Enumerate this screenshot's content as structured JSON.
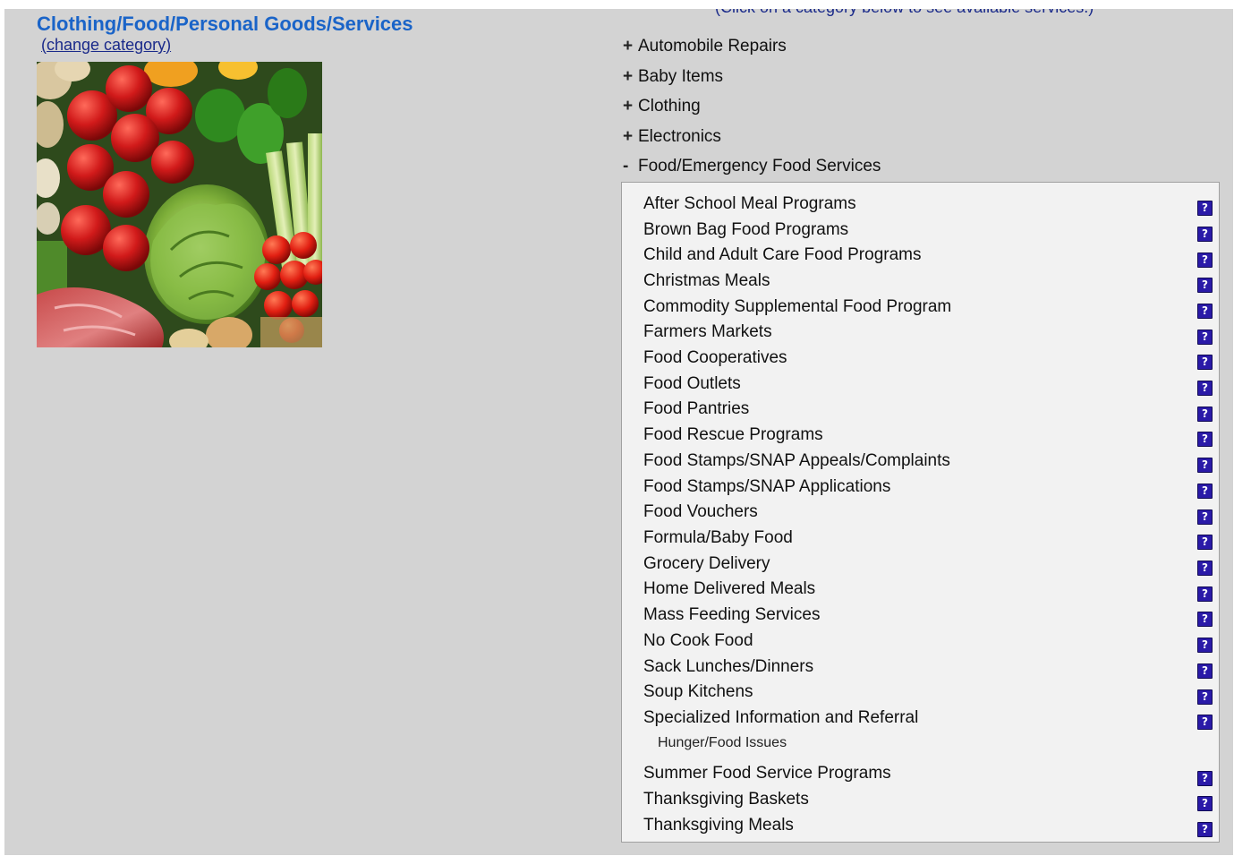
{
  "header": {
    "category_title": "Clothing/Food/Personal Goods/Services",
    "change_open": "(",
    "change_label": "change category",
    "change_close": ")"
  },
  "instructions": "(Click on a category below to see available services.)",
  "categories": [
    {
      "symbol": "+",
      "label": "Automobile Repairs"
    },
    {
      "symbol": "+",
      "label": "Baby Items"
    },
    {
      "symbol": "+",
      "label": "Clothing"
    },
    {
      "symbol": "+",
      "label": "Electronics"
    },
    {
      "symbol": "-",
      "label": "Food/Emergency Food Services"
    }
  ],
  "help_glyph": "?",
  "subcategories": [
    {
      "label": "After School Meal Programs"
    },
    {
      "label": "Brown Bag Food Programs"
    },
    {
      "label": "Child and Adult Care Food Programs"
    },
    {
      "label": "Christmas Meals"
    },
    {
      "label": "Commodity Supplemental Food Program"
    },
    {
      "label": "Farmers Markets"
    },
    {
      "label": "Food Cooperatives"
    },
    {
      "label": "Food Outlets"
    },
    {
      "label": "Food Pantries"
    },
    {
      "label": "Food Rescue Programs"
    },
    {
      "label": "Food Stamps/SNAP Appeals/Complaints"
    },
    {
      "label": "Food Stamps/SNAP Applications"
    },
    {
      "label": "Food Vouchers"
    },
    {
      "label": "Formula/Baby Food"
    },
    {
      "label": "Grocery Delivery"
    },
    {
      "label": "Home Delivered Meals"
    },
    {
      "label": "Mass Feeding Services"
    },
    {
      "label": "No Cook Food"
    },
    {
      "label": "Sack Lunches/Dinners"
    },
    {
      "label": "Soup Kitchens"
    },
    {
      "label": "Specialized Information and Referral",
      "note": "Hunger/Food Issues"
    },
    {
      "label": "Summer Food Service Programs"
    },
    {
      "label": "Thanksgiving Baskets"
    },
    {
      "label": "Thanksgiving Meals"
    }
  ],
  "colors": {
    "title_blue": "#1a64c8",
    "link_navy": "#1a2a8a",
    "help_icon_purple": "#2a1aa8",
    "page_gray": "#d3d3d3",
    "panel_bg": "#f2f2f2"
  }
}
